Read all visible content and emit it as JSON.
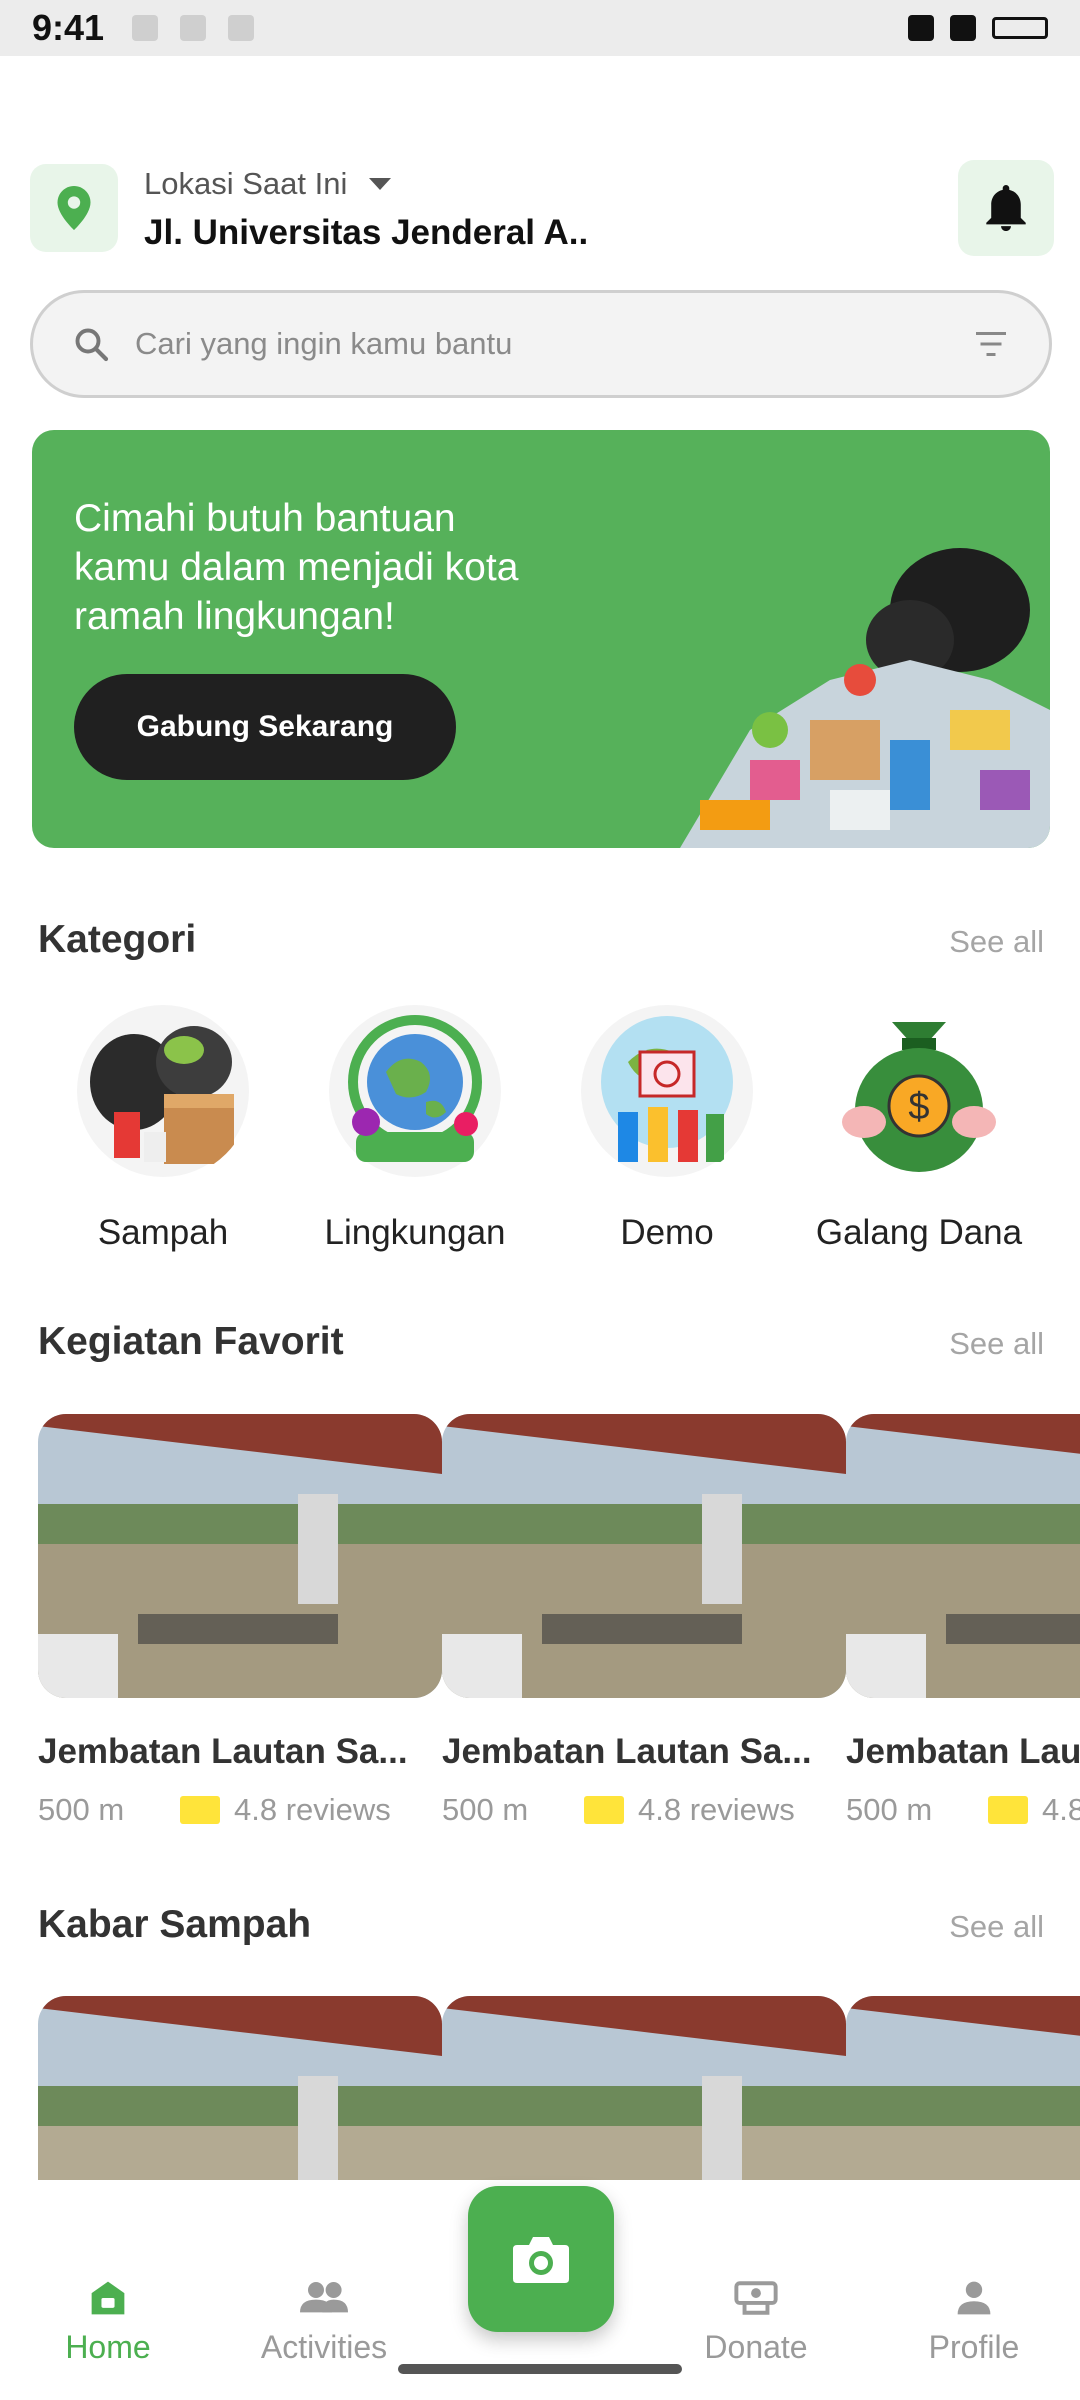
{
  "status_bar": {
    "time": "9:41"
  },
  "location": {
    "label": "Lokasi Saat Ini",
    "value": "Jl. Universitas Jenderal A.."
  },
  "search": {
    "placeholder": "Cari yang ingin kamu bantu"
  },
  "banner": {
    "text": "Cimahi butuh bantuan kamu dalam menjadi kota ramah lingkungan!",
    "button_label": "Gabung Sekarang"
  },
  "categories": {
    "title": "Kategori",
    "see_all": "See all",
    "items": [
      {
        "label": "Sampah",
        "icon": "trash-bags-icon"
      },
      {
        "label": "Lingkungan",
        "icon": "globe-nature-icon"
      },
      {
        "label": "Demo",
        "icon": "protest-icon"
      },
      {
        "label": "Galang Dana",
        "icon": "money-bag-icon"
      }
    ]
  },
  "favorites": {
    "title": "Kegiatan Favorit",
    "see_all": "See all",
    "items": [
      {
        "title": "Jembatan Lautan Sa...",
        "distance": "500 m",
        "reviews": "4.8 reviews"
      },
      {
        "title": "Jembatan Lautan Sa...",
        "distance": "500 m",
        "reviews": "4.8 reviews"
      },
      {
        "title": "Jembatan Lau",
        "distance": "500 m",
        "reviews": "4.8"
      }
    ]
  },
  "news": {
    "title": "Kabar Sampah",
    "see_all": "See all"
  },
  "nav": {
    "home": "Home",
    "activities": "Activities",
    "donate": "Donate",
    "profile": "Profile"
  },
  "colors": {
    "primary": "#4caf50",
    "banner": "#56b15a",
    "dark_button": "#202020",
    "star": "#ffe43a"
  }
}
